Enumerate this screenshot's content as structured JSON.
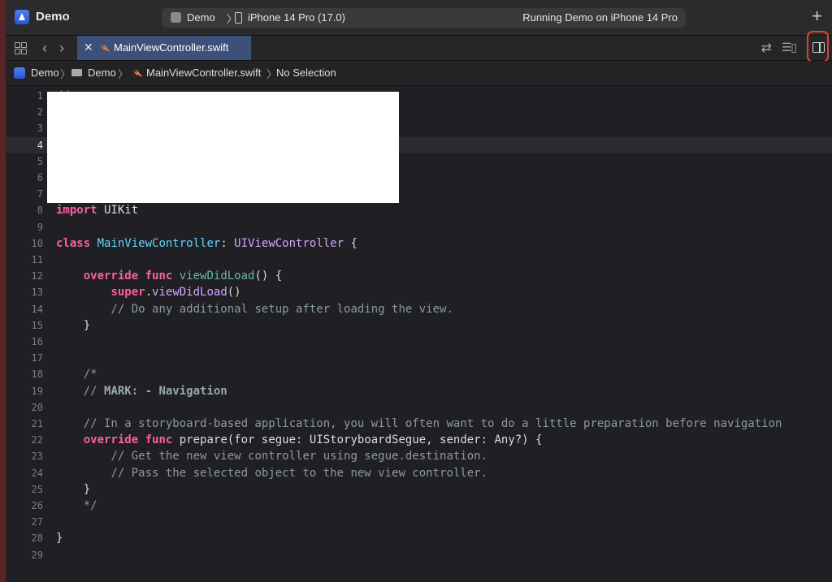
{
  "app": {
    "title": "Demo"
  },
  "scheme": {
    "target": "Demo",
    "separator": "〉",
    "device": "iPhone 14 Pro (17.0)",
    "status": "Running Demo on iPhone 14 Pro"
  },
  "toolbar": {
    "add_icon": "plus-icon",
    "add_label": "+"
  },
  "tab": {
    "label": "MainViewController.swift",
    "close_label": "✕"
  },
  "breadcrumb": {
    "project": "Demo",
    "folder": "Demo",
    "file": "MainViewController.swift",
    "selection": "No Selection",
    "chevron": "〉"
  },
  "colors": {
    "keyword": "#fc5fa3",
    "type": "#d0a8ff",
    "class_name": "#5dd8ff",
    "function": "#67b7a4",
    "comment": "#8b9aa6",
    "tab_active": "#3d5079",
    "highlight": "#e0442b"
  },
  "editor": {
    "current_line": 4,
    "lines": [
      {
        "n": "1",
        "text": "//"
      },
      {
        "n": "2",
        "text": ""
      },
      {
        "n": "3",
        "text": ""
      },
      {
        "n": "4",
        "text": ""
      },
      {
        "n": "5",
        "text": ""
      },
      {
        "n": "6",
        "text": ""
      },
      {
        "n": "7",
        "text": ""
      },
      {
        "n": "8",
        "text": "import UIKit"
      },
      {
        "n": "9",
        "text": ""
      },
      {
        "n": "10",
        "text": "class MainViewController: UIViewController {"
      },
      {
        "n": "11",
        "text": ""
      },
      {
        "n": "12",
        "text": "    override func viewDidLoad() {"
      },
      {
        "n": "13",
        "text": "        super.viewDidLoad()"
      },
      {
        "n": "14",
        "text": "        // Do any additional setup after loading the view."
      },
      {
        "n": "15",
        "text": "    }"
      },
      {
        "n": "16",
        "text": ""
      },
      {
        "n": "17",
        "text": ""
      },
      {
        "n": "18",
        "text": "    /*"
      },
      {
        "n": "19",
        "text": "    // MARK: - Navigation"
      },
      {
        "n": "20",
        "text": ""
      },
      {
        "n": "21",
        "text": "    // In a storyboard-based application, you will often want to do a little preparation before navigation"
      },
      {
        "n": "22",
        "text": "    override func prepare(for segue: UIStoryboardSegue, sender: Any?) {"
      },
      {
        "n": "23",
        "text": "        // Get the new view controller using segue.destination."
      },
      {
        "n": "24",
        "text": "        // Pass the selected object to the new view controller."
      },
      {
        "n": "25",
        "text": "    }"
      },
      {
        "n": "26",
        "text": "    */"
      },
      {
        "n": "27",
        "text": ""
      },
      {
        "n": "28",
        "text": "}"
      },
      {
        "n": "29",
        "text": ""
      }
    ]
  }
}
